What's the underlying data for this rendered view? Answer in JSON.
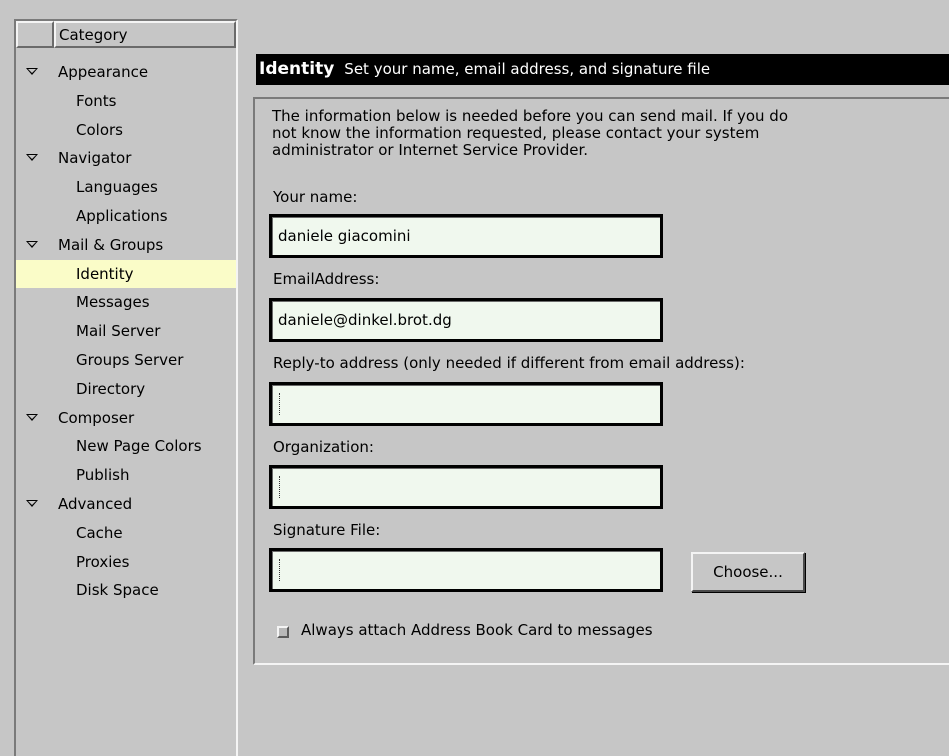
{
  "tree": {
    "header": "Category",
    "items": [
      {
        "label": "Appearance",
        "level": 0,
        "expanded": true
      },
      {
        "label": "Fonts",
        "level": 1
      },
      {
        "label": "Colors",
        "level": 1
      },
      {
        "label": "Navigator",
        "level": 0,
        "expanded": true
      },
      {
        "label": "Languages",
        "level": 1
      },
      {
        "label": "Applications",
        "level": 1
      },
      {
        "label": "Mail & Groups",
        "level": 0,
        "expanded": true
      },
      {
        "label": "Identity",
        "level": 1,
        "selected": true
      },
      {
        "label": "Messages",
        "level": 1
      },
      {
        "label": "Mail Server",
        "level": 1
      },
      {
        "label": "Groups Server",
        "level": 1
      },
      {
        "label": "Directory",
        "level": 1
      },
      {
        "label": "Composer",
        "level": 0,
        "expanded": true
      },
      {
        "label": "New Page Colors",
        "level": 1
      },
      {
        "label": "Publish",
        "level": 1
      },
      {
        "label": "Advanced",
        "level": 0,
        "expanded": true
      },
      {
        "label": "Cache",
        "level": 1
      },
      {
        "label": "Proxies",
        "level": 1
      },
      {
        "label": "Disk Space",
        "level": 1
      }
    ],
    "selected_color": "#fafcc8"
  },
  "panel": {
    "title": "Identity",
    "subtitle": "Set your name, email address, and signature file",
    "intro_lines": [
      "The information below is needed before you can send mail. If you do",
      "not know the information requested, please contact your system",
      "administrator or Internet Service Provider."
    ],
    "fields": {
      "name": {
        "label": "Your name:",
        "value": "daniele giacomini"
      },
      "email": {
        "label": "EmailAddress:",
        "value": "daniele@dinkel.brot.dg"
      },
      "reply_to": {
        "label": "Reply-to address (only needed if different from email address):",
        "value": ""
      },
      "organization": {
        "label": "Organization:",
        "value": ""
      },
      "signature": {
        "label": "Signature File:",
        "value": ""
      }
    },
    "choose_button": "Choose...",
    "attach_card": {
      "label": "Always attach Address Book Card to messages",
      "checked": false
    }
  },
  "colors": {
    "background": "#c6c6c6",
    "field_background": "#f0f8ee",
    "title_bar": "#000000"
  }
}
